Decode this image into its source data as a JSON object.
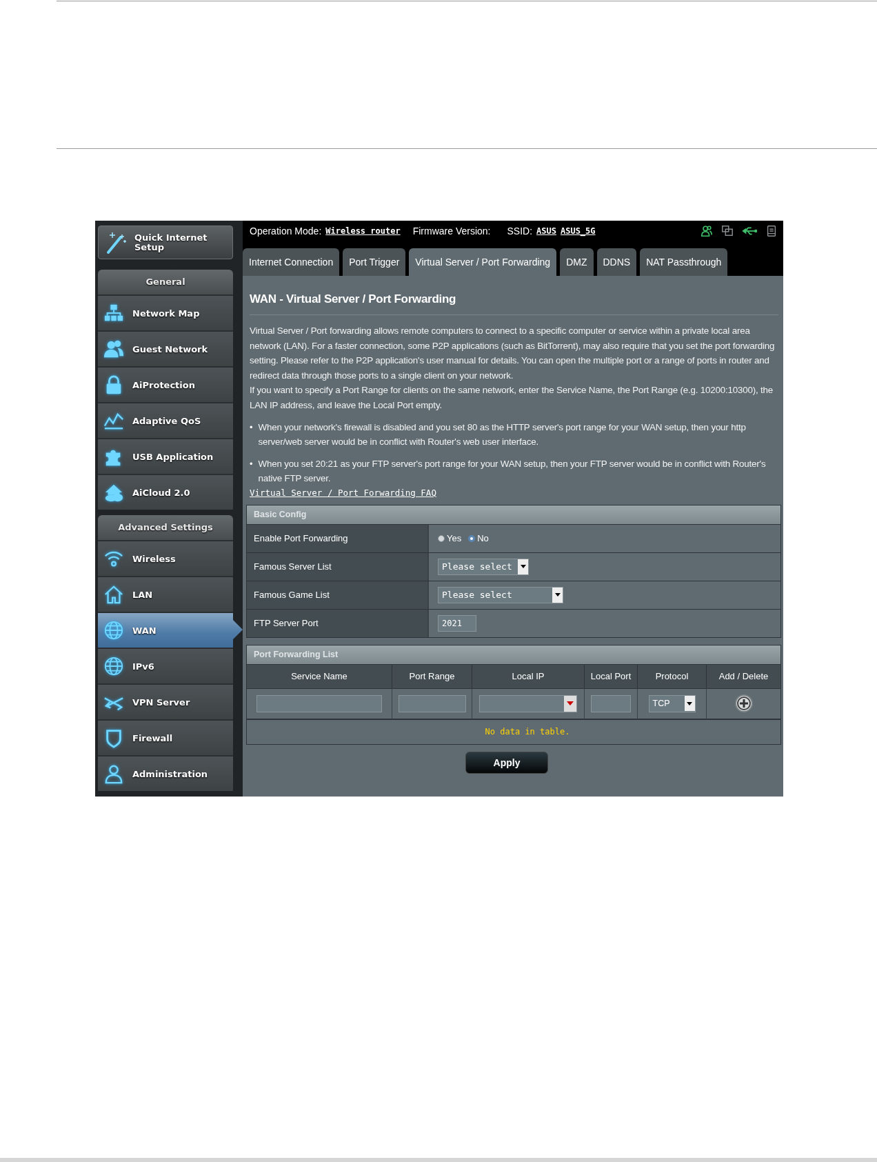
{
  "header": {
    "operation_mode_label": "Operation Mode:",
    "operation_mode": "Wireless router",
    "firmware_label": "Firmware Version:",
    "ssid_label": "SSID:",
    "ssids": [
      "ASUS",
      "ASUS_5G"
    ]
  },
  "tabs": [
    {
      "label": "Internet Connection",
      "selected": false
    },
    {
      "label": "Port Trigger",
      "selected": false
    },
    {
      "label": "Virtual Server / Port Forwarding",
      "selected": true
    },
    {
      "label": "DMZ",
      "selected": false
    },
    {
      "label": "DDNS",
      "selected": false
    },
    {
      "label": "NAT Passthrough",
      "selected": false
    }
  ],
  "sidebar": {
    "quick_setup": "Quick Internet Setup",
    "sections": [
      {
        "title": "General",
        "items": [
          {
            "label": "Network Map",
            "selected": false
          },
          {
            "label": "Guest Network",
            "selected": false
          },
          {
            "label": "AiProtection",
            "selected": false
          },
          {
            "label": "Adaptive QoS",
            "selected": false
          },
          {
            "label": "USB Application",
            "selected": false
          },
          {
            "label": "AiCloud 2.0",
            "selected": false
          }
        ]
      },
      {
        "title": "Advanced Settings",
        "items": [
          {
            "label": "Wireless",
            "selected": false
          },
          {
            "label": "LAN",
            "selected": false
          },
          {
            "label": "WAN",
            "selected": true
          },
          {
            "label": "IPv6",
            "selected": false
          },
          {
            "label": "VPN Server",
            "selected": false
          },
          {
            "label": "Firewall",
            "selected": false
          },
          {
            "label": "Administration",
            "selected": false
          }
        ]
      }
    ]
  },
  "page_title": "WAN - Virtual Server / Port Forwarding",
  "description": [
    "Virtual Server / Port forwarding allows remote computers to connect to a specific computer or service within a private local area network (LAN). For a faster connection, some P2P applications (such as BitTorrent), may also require that you set the port forwarding setting. Please refer to the P2P application's user manual for details. You can open the multiple port or a range of ports in router and redirect data through those ports to a single client on your network.",
    "If you want to specify a Port Range for clients on the same network, enter the Service Name, the Port Range (e.g. 10200:10300), the LAN IP address, and leave the Local Port empty."
  ],
  "notes": [
    {
      "marker": "•",
      "text": "When your network's firewall is disabled and you set 80 as the HTTP server's port range for your WAN setup, then your http server/web server would be in conflict with Router's web user interface."
    },
    {
      "marker": "•",
      "text": "When you set 20:21 as your FTP server's port range for your WAN setup, then your FTP server would be in conflict with Router's native FTP server."
    }
  ],
  "faq_link": "Virtual Server / Port Forwarding FAQ",
  "basic_config": {
    "title": "Basic Config",
    "rows": [
      {
        "label": "Enable Port Forwarding",
        "kind": "radio",
        "options": [
          {
            "label": "Yes",
            "selected": false
          },
          {
            "label": "No",
            "selected": true
          }
        ]
      },
      {
        "label": "Famous Server List",
        "kind": "select",
        "value": "Please select"
      },
      {
        "label": "Famous Game List",
        "kind": "select",
        "value": "Please select"
      },
      {
        "label": "FTP Server Port",
        "kind": "text",
        "value": "2021"
      }
    ]
  },
  "port_forwarding_list": {
    "title": "Port Forwarding List",
    "columns": [
      "Service Name",
      "Port Range",
      "Local IP",
      "Local Port",
      "Protocol",
      "Add / Delete"
    ],
    "protocol": "TCP",
    "empty_message": "No data in table."
  },
  "apply_button": "Apply"
}
